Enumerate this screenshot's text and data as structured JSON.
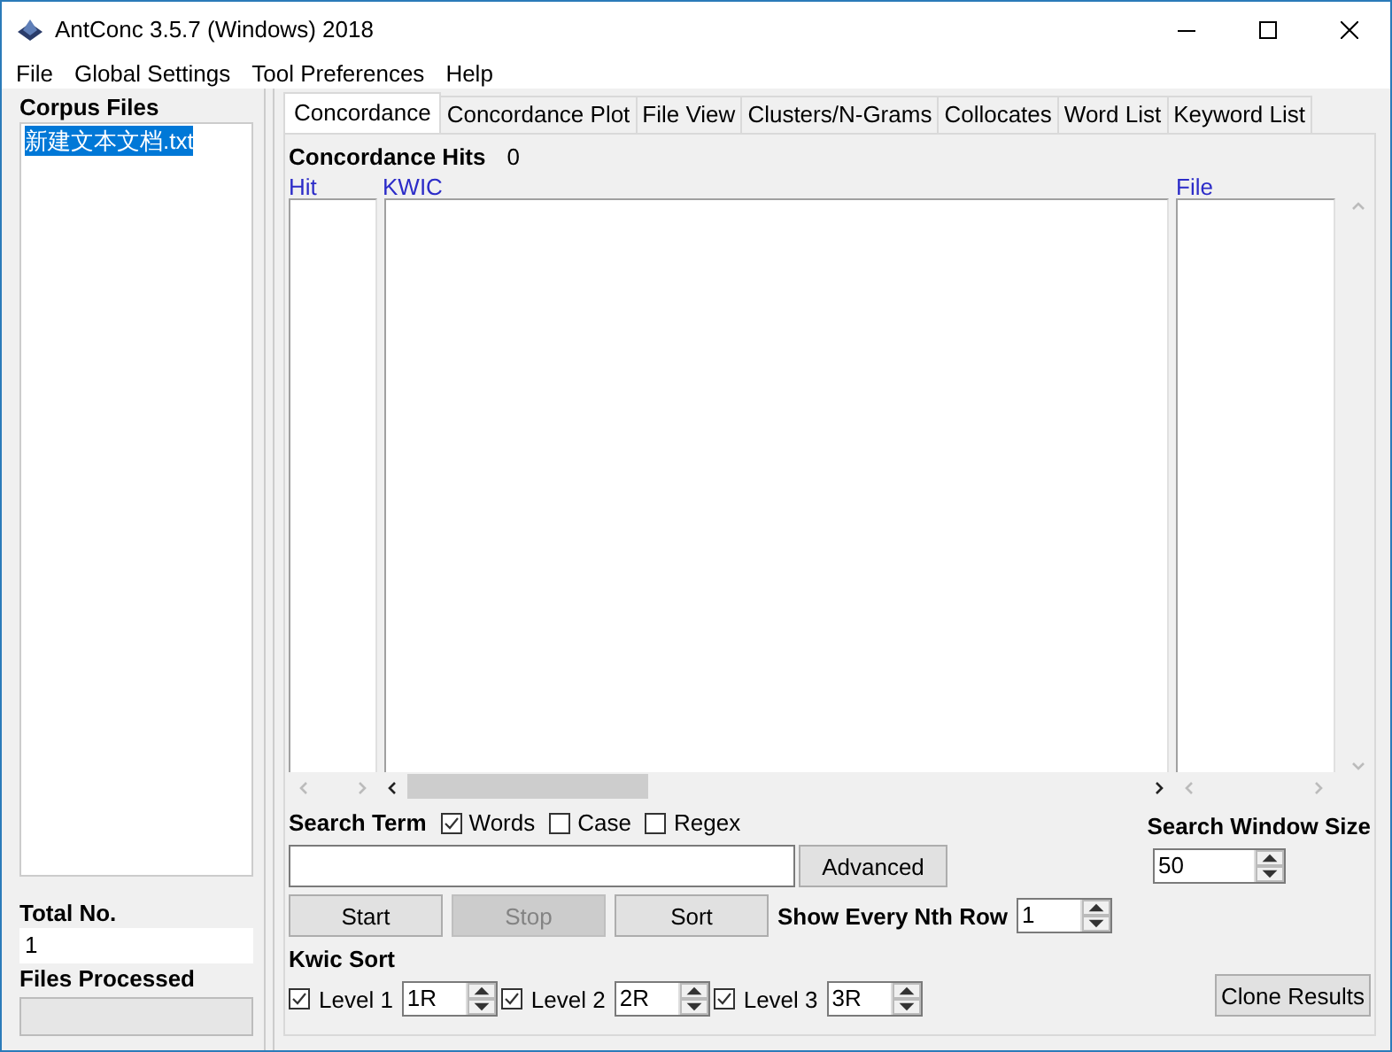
{
  "window": {
    "title": "AntConc 3.5.7 (Windows) 2018"
  },
  "menu": [
    "File",
    "Global Settings",
    "Tool Preferences",
    "Help"
  ],
  "corpus_files": {
    "label": "Corpus Files",
    "files": [
      {
        "name": "新建文本文档.txt",
        "selected": true
      }
    ]
  },
  "total_no": {
    "label": "Total No.",
    "value": "1"
  },
  "files_processed": {
    "label": "Files Processed",
    "level": 0
  },
  "tabs": [
    {
      "label": "Concordance",
      "selected": true
    },
    {
      "label": "Concordance Plot",
      "selected": false
    },
    {
      "label": "File View",
      "selected": false
    },
    {
      "label": "Clusters/N-Grams",
      "selected": false
    },
    {
      "label": "Collocates",
      "selected": false
    },
    {
      "label": "Word List",
      "selected": false
    },
    {
      "label": "Keyword List",
      "selected": false
    }
  ],
  "concordance_hits": {
    "label": "Concordance Hits",
    "value": "0"
  },
  "columns": [
    "Hit",
    "KWIC",
    "File"
  ],
  "search_term": {
    "label": "Search Term",
    "options": [
      {
        "label": "Words",
        "checked": true
      },
      {
        "label": "Case",
        "checked": false
      },
      {
        "label": "Regex",
        "checked": false
      }
    ]
  },
  "advanced_button": "Advanced",
  "buttons": [
    {
      "label": "Start",
      "disabled": false
    },
    {
      "label": "Stop",
      "disabled": true
    },
    {
      "label": "Sort",
      "disabled": false
    }
  ],
  "show_every_nth_row": {
    "label": "Show Every Nth Row",
    "value": "1"
  },
  "kwic_sort": {
    "label": "Kwic Sort",
    "levels": [
      {
        "label": "Level 1",
        "checked": true,
        "value": "1R"
      },
      {
        "label": "Level 2",
        "checked": true,
        "value": "2R"
      },
      {
        "label": "Level 3",
        "checked": true,
        "value": "3R"
      }
    ]
  },
  "search_window_size": {
    "label": "Search Window Size",
    "value": "50"
  },
  "clone_results_button": "Clone Results"
}
